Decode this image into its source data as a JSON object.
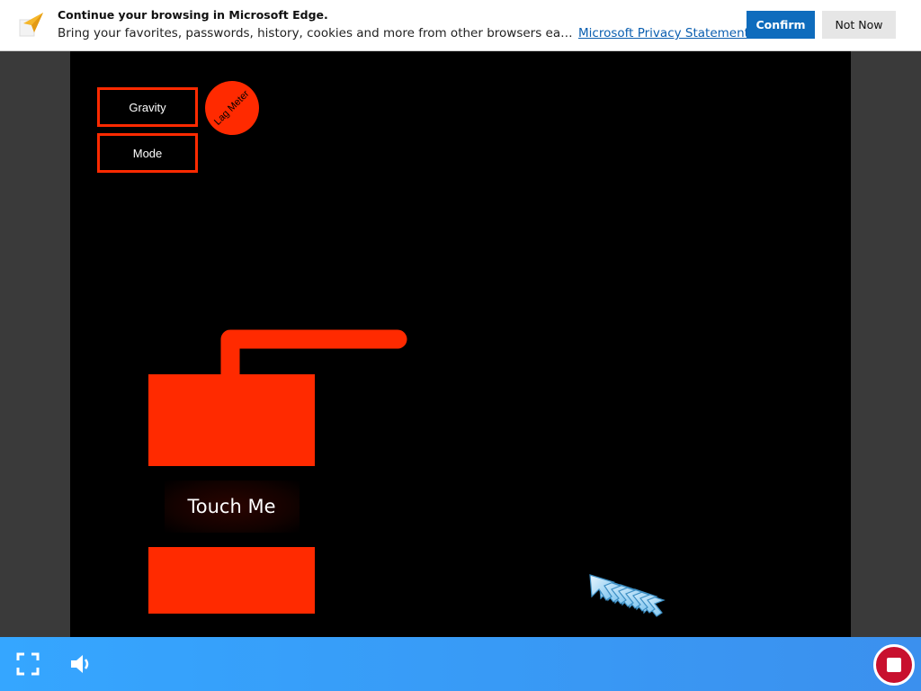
{
  "edge_notification": {
    "title": "Continue your browsing in Microsoft Edge.",
    "description": "Bring your favorites, passwords, history, cookies and more from other browsers each time you start Microsoft Edge.",
    "link": "Microsoft Privacy Statement",
    "confirm_label": "Confirm",
    "not_now_label": "Not Now",
    "icon": "paper-plane-icon"
  },
  "game": {
    "gravity_label": "Gravity",
    "mode_label": "Mode",
    "lag_meter_label": "Lag Meter",
    "touch_label": "Touch Me",
    "accent_color": "#ff2a00",
    "background_color": "#000000"
  },
  "controls": {
    "fullscreen_icon": "fullscreen-icon",
    "volume_icon": "volume-icon",
    "stop_icon": "stop-icon",
    "bar_color": "#3a9cf8",
    "stop_color": "#c8102e"
  }
}
